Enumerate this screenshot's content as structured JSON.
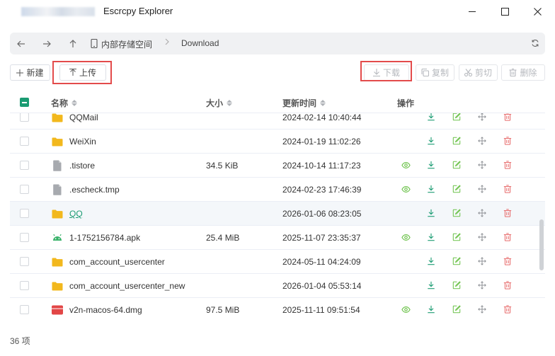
{
  "window": {
    "title": "Escrcpy Explorer",
    "minimize_label": "minimize",
    "maximize_label": "maximize",
    "close_label": "close"
  },
  "address": {
    "storage_name": "内部存储空间",
    "current_folder": "Download"
  },
  "toolbar": {
    "new_label": "新建",
    "upload_label": "上传",
    "download_label": "下载",
    "copy_label": "复制",
    "cut_label": "剪切",
    "delete_label": "删除"
  },
  "table": {
    "columns": {
      "name": "名称",
      "size": "大小",
      "modified": "更新时间",
      "actions": "操作"
    },
    "rows": [
      {
        "name": "QQMail",
        "type": "folder",
        "size": "",
        "modified": "2024-02-14 10:40:44",
        "viewable": false
      },
      {
        "name": "WeiXin",
        "type": "folder",
        "size": "",
        "modified": "2024-01-19 11:02:26",
        "viewable": false
      },
      {
        "name": ".tistore",
        "type": "file",
        "size": "34.5 KiB",
        "modified": "2024-10-14 11:17:23",
        "viewable": true
      },
      {
        "name": ".escheck.tmp",
        "type": "file",
        "size": "",
        "modified": "2024-02-23 17:46:39",
        "viewable": true
      },
      {
        "name": "QQ",
        "type": "folder",
        "size": "",
        "modified": "2026-01-06 08:23:05",
        "viewable": false,
        "hovered": true
      },
      {
        "name": "1-1752156784.apk",
        "type": "apk",
        "size": "25.4 MiB",
        "modified": "2025-11-07 23:35:37",
        "viewable": true
      },
      {
        "name": "com_account_usercenter",
        "type": "folder",
        "size": "",
        "modified": "2024-05-11 04:24:09",
        "viewable": false
      },
      {
        "name": "com_account_usercenter_new",
        "type": "folder",
        "size": "",
        "modified": "2026-01-04 05:53:14",
        "viewable": false
      },
      {
        "name": "v2n-macos-64.dmg",
        "type": "dmg",
        "size": "97.5 MiB",
        "modified": "2025-11-11 09:51:54",
        "viewable": true
      }
    ]
  },
  "footer": {
    "count_text": "36 项"
  },
  "colors": {
    "accent": "#1a9b72",
    "highlight_border": "#e34b4b",
    "folder": "#f2b81d",
    "delete": "#e76b6b",
    "view": "#6cc24a"
  }
}
